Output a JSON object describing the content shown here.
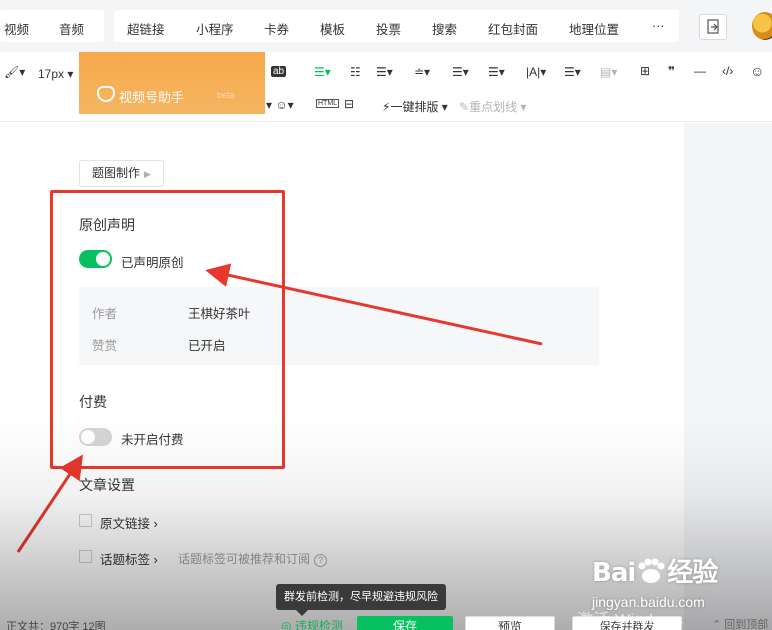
{
  "topbar": {
    "items": [
      "视频",
      "音频",
      "超链接",
      "小程序",
      "卡券",
      "模板",
      "投票",
      "搜索",
      "红包封面",
      "地理位置",
      "···"
    ]
  },
  "toolbar": {
    "font_size": "17px",
    "oneclick_layout": "一键排版",
    "highlight": "重点划线",
    "html_label": "HTML"
  },
  "promo": {
    "title": "视频号助手",
    "tag": "beta"
  },
  "content": {
    "title_making": "题图制作",
    "original": {
      "heading": "原创声明",
      "toggle_label": "已声明原创",
      "toggle_on": true,
      "rows": [
        {
          "key": "作者",
          "value": "王棋好茶叶"
        },
        {
          "key": "赞赏",
          "value": "已开启"
        }
      ]
    },
    "paid": {
      "heading": "付费",
      "toggle_label": "未开启付费",
      "toggle_on": false
    },
    "article_settings": {
      "heading": "文章设置",
      "original_link": "原文链接",
      "topic_tags": "话题标签",
      "topic_hint": "话题标签可被推荐和订阅"
    }
  },
  "bottom": {
    "tooltip": "群发前检测，尽早规避违规风险",
    "word_count": "正文共：970字 12图",
    "check_label": "违规检测",
    "save_label": "保存",
    "preview_label": "预览",
    "publish_label": "保存并群发",
    "activate_windows": "激活 Windows",
    "back_to_top": "回到顶部"
  },
  "watermark": {
    "brand": "Bai",
    "brand_cn": "经验",
    "url": "jingyan.baidu.com"
  },
  "colors": {
    "accent_green": "#07c160",
    "highlight_red": "#e8382e",
    "promo_orange": "#f7a94a"
  }
}
